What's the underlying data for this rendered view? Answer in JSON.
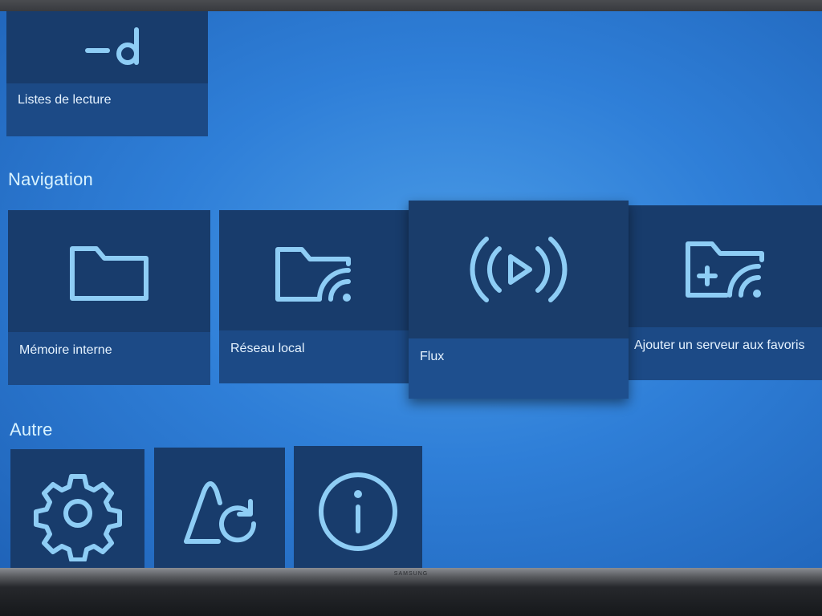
{
  "top_card": {
    "label": "Listes de lecture",
    "icon": "playlist-icon"
  },
  "sections": {
    "navigation": {
      "title": "Navigation"
    },
    "other": {
      "title": "Autre"
    }
  },
  "navigation_items": [
    {
      "label": "Mémoire interne",
      "icon": "folder-icon"
    },
    {
      "label": "Réseau local",
      "icon": "network-folder-icon"
    },
    {
      "label": "Flux",
      "icon": "stream-icon",
      "focused": true
    },
    {
      "label": "Ajouter un serveur aux favoris",
      "icon": "add-server-folder-icon"
    }
  ],
  "other_items": [
    {
      "icon": "settings-gear-icon"
    },
    {
      "icon": "refresh-triangle-icon"
    },
    {
      "icon": "info-icon"
    }
  ],
  "tv": {
    "brand": "SAMSUNG"
  },
  "colors": {
    "background": "#2f7fd8",
    "card": "#1c4a86",
    "card_icon_area": "#183c6c",
    "icon": "#8ecdf5",
    "title_text": "#d9f3ff"
  }
}
